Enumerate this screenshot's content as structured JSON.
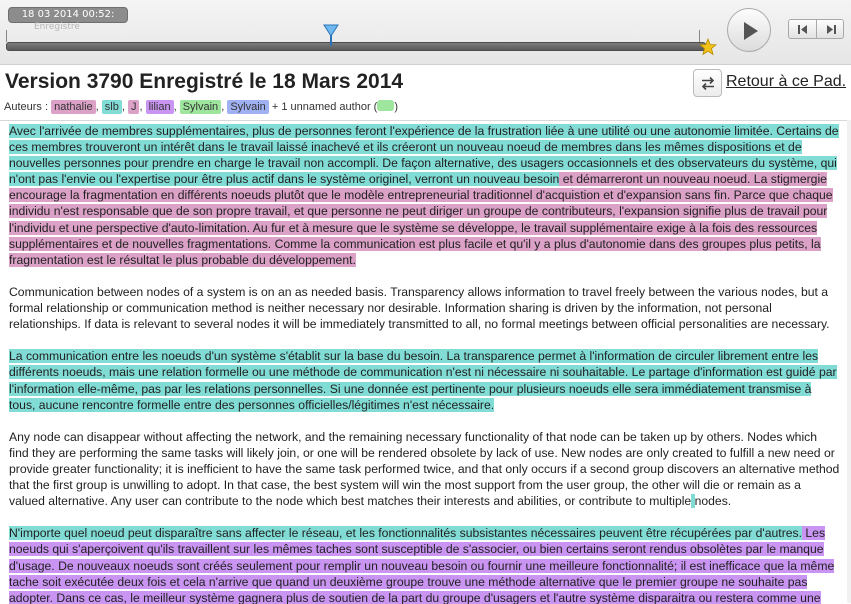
{
  "colors": {
    "teal": "#80dcd5",
    "pink": "#dca1c7",
    "violet": "#ca95f2",
    "green": "#9ee69e",
    "blue": "#9fb1f2"
  },
  "timeslider": {
    "timestamp": "18 03 2014 00:52:",
    "timestamp_sub": "Enregistré",
    "play_icon": "play-icon",
    "prev_icon": "step-back-icon",
    "next_icon": "step-forward-icon",
    "star_icon": "star-icon",
    "handle_icon": "slider-handle-icon"
  },
  "header": {
    "title": "Version 3790 Enregistré le 18 Mars 2014",
    "return_link": "Retour à ce Pad.",
    "return_icon": "swap-arrows-icon"
  },
  "authors": {
    "label": "Auteurs :",
    "list": [
      {
        "name": "nathalie",
        "color": "#dca1c7"
      },
      {
        "name": "slb",
        "color": "#80dcd5"
      },
      {
        "name": "J",
        "color": "#dca1c7"
      },
      {
        "name": "lilian",
        "color": "#ca95f2"
      },
      {
        "name": "Sylvain",
        "color": "#9ee69e"
      },
      {
        "name": "Sylvain",
        "color": "#9fb1f2"
      }
    ],
    "unnamed": "+ 1 unnamed author (",
    "unnamed_end": ")",
    "unnamed_color": "#9ee69e"
  },
  "document": {
    "p1_a": "Avec l'arrivée de membres supplémentaires, plus de personnes feront l'expérience de la frustration liée à une utilité ou une autonomie limitée. Certains de ces membres trouveront un intérêt dans le travail laissé inachevé et ils créeront un nouveau noeud de membres dans les mêmes dispositions et de nouvelles personnes pour prendre en charge le travail non accompli. De façon alternative, des usagers occasionnels et des observateurs du système, qui n'ont pas l'envie ou l'expertise pour être plus actif dans le système originel, verront un nouveau besoin",
    "p1_b": " et démarreront un nouveau noeud. La stigmergie encourage la fragmentation en différents noeuds plutôt que le modèle entrepreneurial traditionnel d'acquistion et d'expansion sans fin. Parce que chaque individu n'est responsable que de son propre travail, et que personne ne peut diriger un groupe de contributeurs, l'expansion signifie plus de travail pour l'individu et une perspective d'auto-limitation. Au fur et à mesure que le système se développe, le travail supplémentaire exige à la fois des ressources supplémentaires et de nouvelles fragmentations. Comme la communication est plus facile et qu'il y a plus d'autonomie dans des groupes plus petits, la fragmentation est le résultat le plus probable du développement.",
    "p2": "Communication between nodes of a system is on an as needed basis. Transparency allows information to travel freely between the various nodes, but a formal relationship or communication method is neither necessary nor desirable. Information sharing is driven by the information, not personal relationships. If data is relevant to several nodes it will be immediately transmitted to all, no formal meetings between official personalities are necessary.",
    "p3": "La communication entre les noeuds d'un système s'établit sur la base du besoin. La transparence permet à l'information de circuler librement entre les différents noeuds, mais une relation formelle ou une méthode de communication n'est ni nécessaire ni souhaitable. Le partage d'information est guidé par l'information elle-même, pas par les relations personnelles. Si une donnée est pertinente pour plusieurs noeuds elle sera immédiatement transmise à tous, aucune rencontre formelle entre des personnes officielles/légitimes n'est nécessaire.",
    "p4_a": "Any node can disappear without affecting the network, and the remaining necessary functionality of that node can be taken up by others. Nodes which find they are performing the same tasks will likely join, or one will be rendered obsolete by lack of use. New nodes are only created to fulfill a new need or provide greater functionality; it is inefficient to have the same task performed twice, and that only occurs if a second group discovers an alternative method that the first group is unwilling to adopt. In that case, the best system will win the most support from the user group, the other will die or remain as a valued alternative. Any user can contribute to the node which best matches their interests and abilities, or contribute to multiple",
    "p4_b": " ",
    "p4_c": "nodes.",
    "p5_a": "N'importe quel noeud peut disparaître sans affecter le réseau, et les fonctionnalités subsistantes nécessaires peuvent être récupérées par d'autres.",
    "p5_b": " Les noeuds qui s'aperçoivent qu'ils travaillent sur les mêmes taches ",
    "p5_c": " sont susceptible de s'associer, ou bien certains seront rendus obsolètes par le manque d'usage. De nouveaux noeuds sont créés seulement pour remplir un nouveau besoin ou fournir une meilleure fonctionnalité; il est inefficace que la même tache soit exécutée deux fois et cela n'arrive que quand un deuxième groupe trouve une méthode alternative que le premier groupe ne souhaite pas adopter. Dans ce cas, le meilleur système gagnera plus de soutien de la part du groupe d'usagers et l'autre système disparaitra ou restera comme une"
  }
}
